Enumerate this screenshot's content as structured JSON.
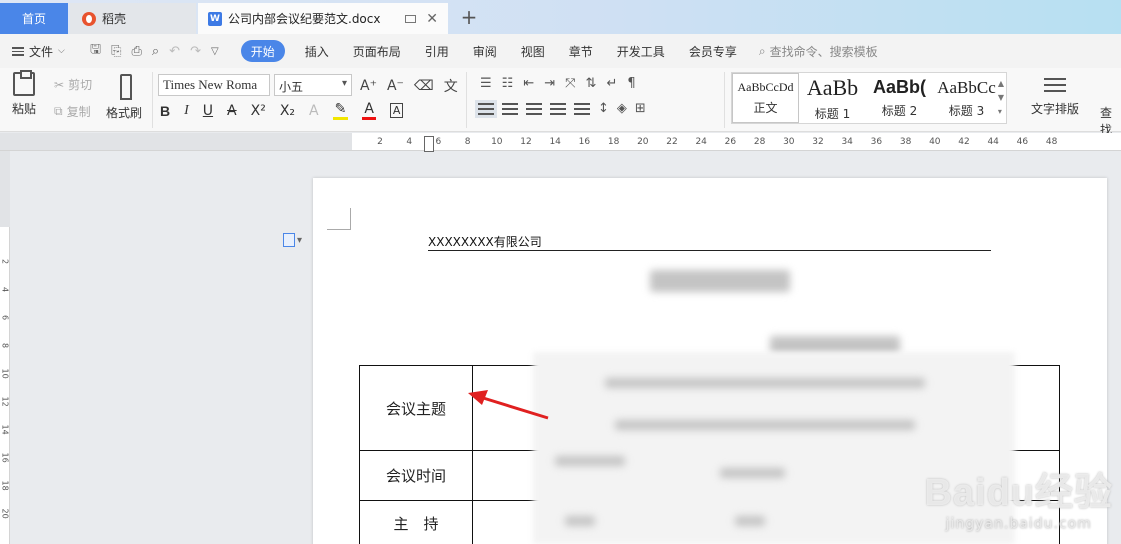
{
  "tabs": {
    "home": "首页",
    "daoke": "稻壳",
    "document": "公司内部会议纪要范文.docx",
    "new_tab": "+"
  },
  "menu": {
    "file": "文件",
    "items": [
      "开始",
      "插入",
      "页面布局",
      "引用",
      "审阅",
      "视图",
      "章节",
      "开发工具",
      "会员专享"
    ],
    "search_placeholder": "查找命令、搜索模板"
  },
  "ribbon": {
    "paste": "粘贴",
    "cut": "剪切",
    "copy": "复制",
    "format_painter": "格式刷",
    "font_name": "Times New Roma",
    "font_size": "小五",
    "styles": [
      {
        "sample": "AaBbCcDd",
        "label": "正文"
      },
      {
        "sample": "AaBb",
        "label": "标题 1"
      },
      {
        "sample": "AaBb(",
        "label": "标题 2"
      },
      {
        "sample": "AaBbCc",
        "label": "标题 3"
      }
    ],
    "text_layout": "文字排版",
    "find": "查找"
  },
  "ruler": {
    "h_ticks": [
      "2",
      "4",
      "6",
      "8",
      "10",
      "12",
      "14",
      "16",
      "18",
      "20",
      "22",
      "24",
      "26",
      "28",
      "30",
      "32",
      "34",
      "36",
      "38",
      "40",
      "42",
      "44",
      "46",
      "48"
    ],
    "v_ticks": [
      "2",
      "2",
      "4",
      "6",
      "8",
      "10",
      "12",
      "14",
      "16",
      "18",
      "20"
    ]
  },
  "document": {
    "header_company": "XXXXXXXX有限公司",
    "table_labels": [
      "会议主题",
      "会议时间",
      "主　持"
    ]
  },
  "watermark": {
    "main": "Baidu经验",
    "sub": "jingyan.baidu.com"
  }
}
